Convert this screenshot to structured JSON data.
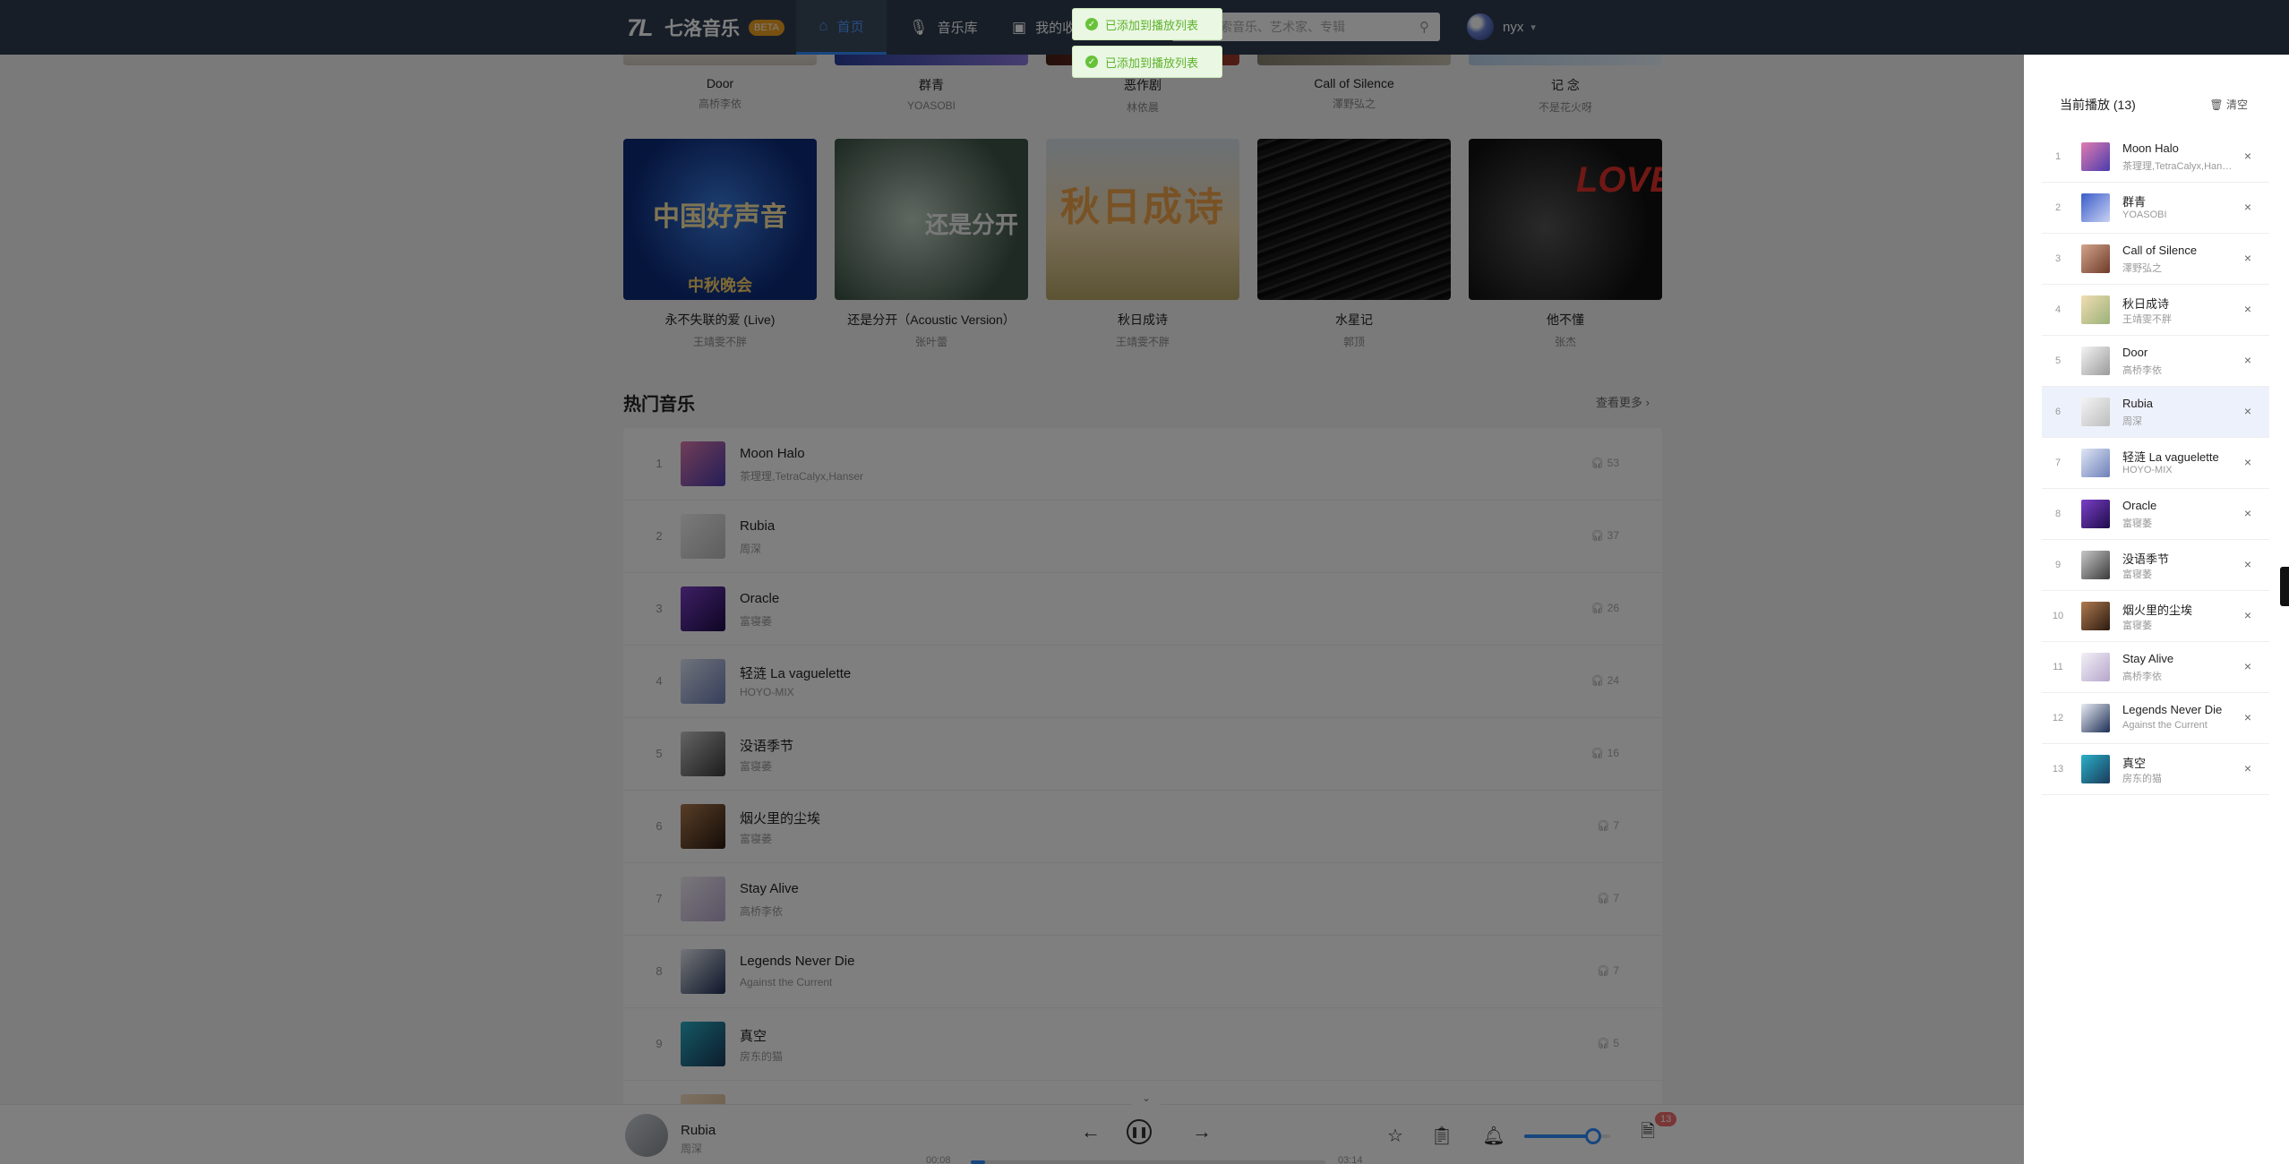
{
  "nav": {
    "logo_mark": "7L",
    "app_name": "七洛音乐",
    "badge": "BETA",
    "home_label": "首页",
    "library_label": "音乐库",
    "fav_label": "我的收藏"
  },
  "search": {
    "placeholder": "搜索音乐、艺术家、专辑"
  },
  "user": {
    "name": "nyx"
  },
  "toasts": [
    "已添加到播放列表",
    "已添加到播放列表"
  ],
  "albums_top": [
    {
      "title": "Door",
      "artist": "高桥李依"
    },
    {
      "title": "群青",
      "artist": "YOASOBI"
    },
    {
      "title": "恶作剧",
      "artist": "林依晨"
    },
    {
      "title": "Call of Silence",
      "artist": "澤野弘之"
    },
    {
      "title": "记 念",
      "artist": "不是花火呀"
    }
  ],
  "albums": [
    {
      "title": "永不失联的爱 (Live)",
      "artist": "王靖雯不胖",
      "cover_text": "中国好声音",
      "cover_sub": "中秋晚会"
    },
    {
      "title": "还是分开（Acoustic Version）",
      "artist": "张叶蕾",
      "cover_text": "还是分开"
    },
    {
      "title": "秋日成诗",
      "artist": "王靖雯不胖",
      "cover_text": "秋日成诗"
    },
    {
      "title": "水星记",
      "artist": "郭顶"
    },
    {
      "title": "他不懂",
      "artist": "张杰",
      "cover_text": "LOVE"
    }
  ],
  "hot": {
    "title": "热门音乐",
    "more": "查看更多 ›",
    "songs": [
      {
        "rank": "1",
        "name": "Moon Halo",
        "artist": "茶理理,TetraCalyx,Hanser",
        "plays": "53"
      },
      {
        "rank": "2",
        "name": "Rubia",
        "artist": "周深",
        "plays": "37"
      },
      {
        "rank": "3",
        "name": "Oracle",
        "artist": "富寝萎",
        "plays": "26"
      },
      {
        "rank": "4",
        "name": "轻涟 La vaguelette",
        "artist": "HOYO-MIX",
        "plays": "24"
      },
      {
        "rank": "5",
        "name": "没语季节",
        "artist": "富寝萎",
        "plays": "16"
      },
      {
        "rank": "6",
        "name": "烟火里的尘埃",
        "artist": "富寝萎",
        "plays": "7"
      },
      {
        "rank": "7",
        "name": "Stay Alive",
        "artist": "高桥李依",
        "plays": "7"
      },
      {
        "rank": "8",
        "name": "Legends Never Die",
        "artist": "Against the Current",
        "plays": "7"
      },
      {
        "rank": "9",
        "name": "真空",
        "artist": "房东的猫",
        "plays": "5"
      }
    ]
  },
  "player": {
    "title": "Rubia",
    "artist": "周深",
    "time_current": "00:08",
    "time_total": "03:14",
    "progress": 0.04,
    "volume": 0.8,
    "queue_count": "13"
  },
  "queue": {
    "title": "当前播放 (13)",
    "clear_label": "清空",
    "active_index": 5,
    "items": [
      {
        "n": "1",
        "name": "Moon Halo",
        "artist": "茶理理,TetraCalyx,Hanser"
      },
      {
        "n": "2",
        "name": "群青",
        "artist": "YOASOBI"
      },
      {
        "n": "3",
        "name": "Call of Silence",
        "artist": "澤野弘之"
      },
      {
        "n": "4",
        "name": "秋日成诗",
        "artist": "王靖雯不胖"
      },
      {
        "n": "5",
        "name": "Door",
        "artist": "高桥李依"
      },
      {
        "n": "6",
        "name": "Rubia",
        "artist": "周深"
      },
      {
        "n": "7",
        "name": "轻涟 La vaguelette",
        "artist": "HOYO-MIX"
      },
      {
        "n": "8",
        "name": "Oracle",
        "artist": "富寝萎"
      },
      {
        "n": "9",
        "name": "没语季节",
        "artist": "富寝萎"
      },
      {
        "n": "10",
        "name": "烟火里的尘埃",
        "artist": "富寝萎"
      },
      {
        "n": "11",
        "name": "Stay Alive",
        "artist": "高桥李依"
      },
      {
        "n": "12",
        "name": "Legends Never Die",
        "artist": "Against the Current"
      },
      {
        "n": "13",
        "name": "真空",
        "artist": "房东的猫"
      }
    ]
  },
  "colors": {
    "accent": "#2f8cff",
    "nav_bg": "#2f3d50",
    "badge": "#f0a020",
    "toast_text": "#5fb32c",
    "queue_badge": "#f56c6c"
  }
}
